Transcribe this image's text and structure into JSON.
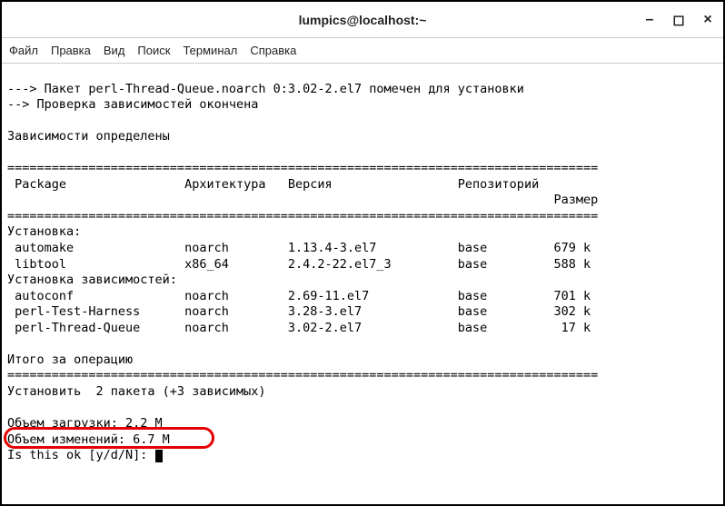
{
  "window": {
    "title": "lumpics@localhost:~"
  },
  "menu": {
    "file": "Файл",
    "edit": "Правка",
    "view": "Вид",
    "search": "Поиск",
    "terminal": "Терминал",
    "help": "Справка"
  },
  "output": {
    "line1": "---> Пакет perl-Thread-Queue.noarch 0:3.02-2.el7 помечен для установки",
    "line2": "--> Проверка зависимостей окончена",
    "blank1": "",
    "deps_resolved": "Зависимости определены",
    "blank2": "",
    "rule1": "================================================================================",
    "header": " Package                Архитектура   Версия                 Репозиторий",
    "header2": "                                                                          Размер",
    "rule2": "================================================================================",
    "installing": "Установка:",
    "pkg1": " automake               noarch        1.13.4-3.el7           base         679 k",
    "pkg2": " libtool                x86_64        2.4.2-22.el7_3         base         588 k",
    "deps_installing": "Установка зависимостей:",
    "pkg3": " autoconf               noarch        2.69-11.el7            base         701 k",
    "pkg4": " perl-Test-Harness      noarch        3.28-3.el7             base         302 k",
    "pkg5": " perl-Thread-Queue      noarch        3.02-2.el7             base          17 k",
    "blank3": "",
    "summary": "Итого за операцию",
    "rule3": "================================================================================",
    "install_summary": "Установить  2 пакета (+3 зависимых)",
    "blank4": "",
    "download_size": "Объем загрузки: 2.2 M",
    "installed_size": "Объем изменений: 6.7 M",
    "prompt": "Is this ok [y/d/N]: "
  }
}
